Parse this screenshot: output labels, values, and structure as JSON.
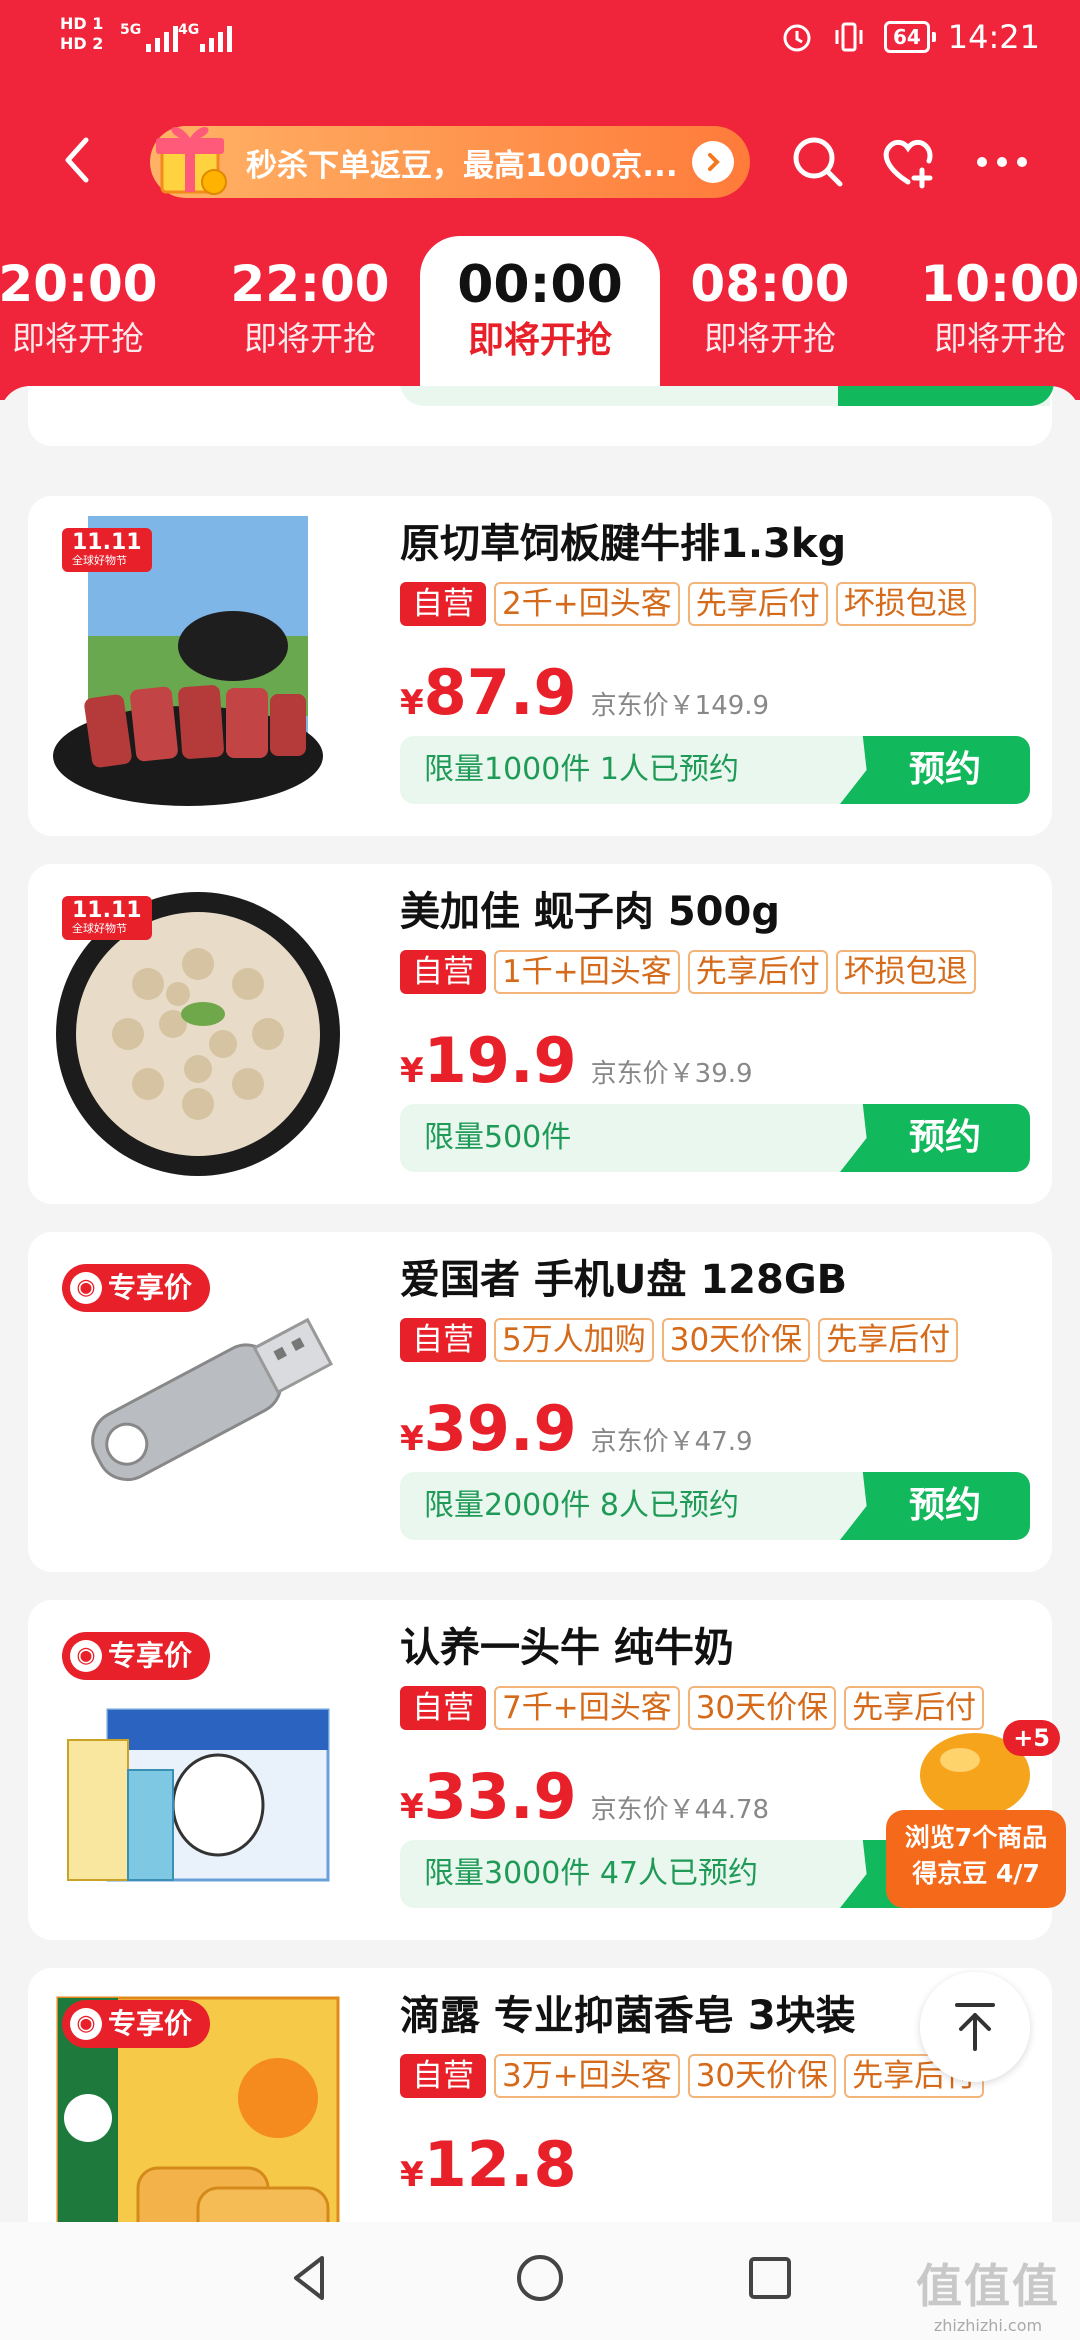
{
  "status_bar": {
    "hd1": "HD 1",
    "hd2": "HD 2",
    "net1": "5G",
    "net2": "4G",
    "battery": "64",
    "time": "14:21"
  },
  "header": {
    "promo_text": "秒杀下单返豆，最高1000京...",
    "icons": [
      "back-icon",
      "gift-icon",
      "search-icon",
      "heart-plus-icon",
      "more-icon"
    ]
  },
  "tabs": [
    {
      "time": "20:00",
      "label": "即将开抢"
    },
    {
      "time": "22:00",
      "label": "即将开抢"
    },
    {
      "time": "00:00",
      "label": "即将开抢"
    },
    {
      "time": "08:00",
      "label": "即将开抢"
    },
    {
      "time": "10:00",
      "label": "即将开抢"
    }
  ],
  "products": [
    {
      "badge": "11.11",
      "badge_sub": "全球好物节",
      "title": "原切草饲板腱牛排1.3kg",
      "tags": [
        "自营",
        "2千+回头客",
        "先享后付",
        "坏损包退"
      ],
      "currency": "¥",
      "price": "87.9",
      "jd_price": "京东价￥149.9",
      "limit": "限量1000件 1人已预约",
      "button": "预约"
    },
    {
      "badge": "11.11",
      "badge_sub": "全球好物节",
      "title": "美加佳 蚬子肉 500g",
      "tags": [
        "自营",
        "1千+回头客",
        "先享后付",
        "坏损包退"
      ],
      "currency": "¥",
      "price": "19.9",
      "jd_price": "京东价￥39.9",
      "limit": "限量500件",
      "button": "预约"
    },
    {
      "badge": "专享价",
      "title": "爱国者 手机U盘 128GB",
      "tags": [
        "自营",
        "5万人加购",
        "30天价保",
        "先享后付"
      ],
      "currency": "¥",
      "price": "39.9",
      "jd_price": "京东价￥47.9",
      "limit": "限量2000件 8人已预约",
      "button": "预约"
    },
    {
      "badge": "专享价",
      "title": "认养一头牛 纯牛奶",
      "tags": [
        "自营",
        "7千+回头客",
        "30天价保",
        "先享后付"
      ],
      "currency": "¥",
      "price": "33.9",
      "jd_price": "京东价￥44.78",
      "limit": "限量3000件 47人已预约",
      "button": "预约"
    },
    {
      "badge": "专享价",
      "title": "滴露 专业抑菌香皂 3块装",
      "tags": [
        "自营",
        "3万+回头客",
        "30天价保",
        "先享后付"
      ],
      "currency": "¥",
      "price": "12.8"
    }
  ],
  "floating": {
    "bean_plus": "+5",
    "bean_line1": "浏览7个商品",
    "bean_line2": "得京豆 4/7"
  },
  "watermark": {
    "big": "值值值",
    "small": "zhizhizhi.com"
  },
  "colors": {
    "brand_red": "#f0253b",
    "price_red": "#e8202a",
    "reserve_green": "#12b85c"
  }
}
